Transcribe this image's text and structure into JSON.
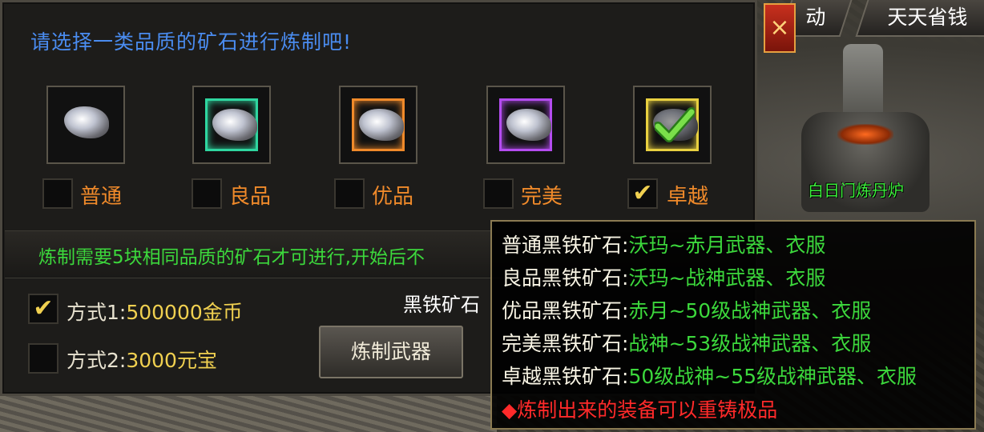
{
  "background": {
    "furnace_label": "白日门炼丹炉"
  },
  "tabs": [
    {
      "label": "动"
    },
    {
      "label": "天天省钱"
    }
  ],
  "close_button": {
    "label": "×"
  },
  "panel": {
    "title": "请选择一类品质的矿石进行炼制吧!",
    "qualities": [
      {
        "label": "普通",
        "checked": false,
        "frame_color": "#6a6a6a"
      },
      {
        "label": "良品",
        "checked": false,
        "frame_color": "#2fd6a0"
      },
      {
        "label": "优品",
        "checked": false,
        "frame_color": "#f08a2a"
      },
      {
        "label": "完美",
        "checked": false,
        "frame_color": "#b44cf0"
      },
      {
        "label": "卓越",
        "checked": true,
        "frame_color": "#e8d040"
      }
    ],
    "notice": "炼制需要5块相同品质的矿石才可进行,开始后不",
    "methods": [
      {
        "label": "方式1:",
        "cost": "500000金币",
        "checked": true
      },
      {
        "label": "方式2:",
        "cost": "3000元宝",
        "checked": false
      }
    ],
    "forge_button": "炼制武器",
    "ore_name": "黑铁矿石"
  },
  "tooltip": {
    "rows": [
      {
        "name": "普通黑铁矿石:",
        "value": "沃玛~赤月武器、衣服"
      },
      {
        "name": "良品黑铁矿石:",
        "value": "沃玛~战神武器、衣服"
      },
      {
        "name": "优品黑铁矿石:",
        "value": "赤月~50级战神武器、衣服"
      },
      {
        "name": "完美黑铁矿石:",
        "value": "战神~53级战神武器、衣服"
      },
      {
        "name": "卓越黑铁矿石:",
        "value": "50级战神~55级战神武器、衣服"
      }
    ],
    "warning": "◆炼制出来的装备可以重铸极品"
  },
  "colors": {
    "title_blue": "#4a8cf0",
    "quality_orange": "#f08a2a",
    "notice_green": "#3cd83c",
    "cost_yellow": "#f0d050",
    "warning_red": "#ff2a2a"
  }
}
